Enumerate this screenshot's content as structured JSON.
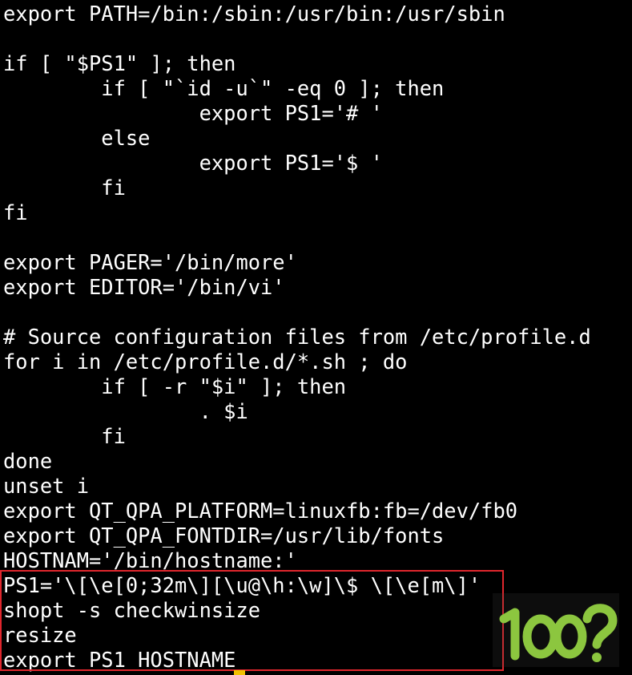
{
  "terminal": {
    "lines": [
      "export PATH=/bin:/sbin:/usr/bin:/usr/sbin",
      "",
      "if [ \"$PS1\" ]; then",
      "        if [ \"`id -u`\" -eq 0 ]; then",
      "                export PS1='# '",
      "        else",
      "                export PS1='$ '",
      "        fi",
      "fi",
      "",
      "export PAGER='/bin/more'",
      "export EDITOR='/bin/vi'",
      "",
      "# Source configuration files from /etc/profile.d",
      "for i in /etc/profile.d/*.sh ; do",
      "        if [ -r \"$i\" ]; then",
      "                . $i",
      "        fi",
      "done",
      "unset i",
      "export QT_QPA_PLATFORM=linuxfb:fb=/dev/fb0",
      "export QT_QPA_FONTDIR=/usr/lib/fonts",
      "HOSTNAM='/bin/hostname:'",
      "PS1='\\[\\e[0;32m\\][\\u@\\h:\\w]\\$ \\[\\e[m\\]'",
      "shopt -s checkwinsize",
      "resize",
      "export PS1 HOSTNAME"
    ]
  },
  "colors": {
    "background": "#000000",
    "text": "#ffffff",
    "highlight_border": "#e0262d",
    "cursor": "#f0c000",
    "watermark": "#8cc63f"
  },
  "icons": {
    "watermark": "site-logo-icon"
  }
}
